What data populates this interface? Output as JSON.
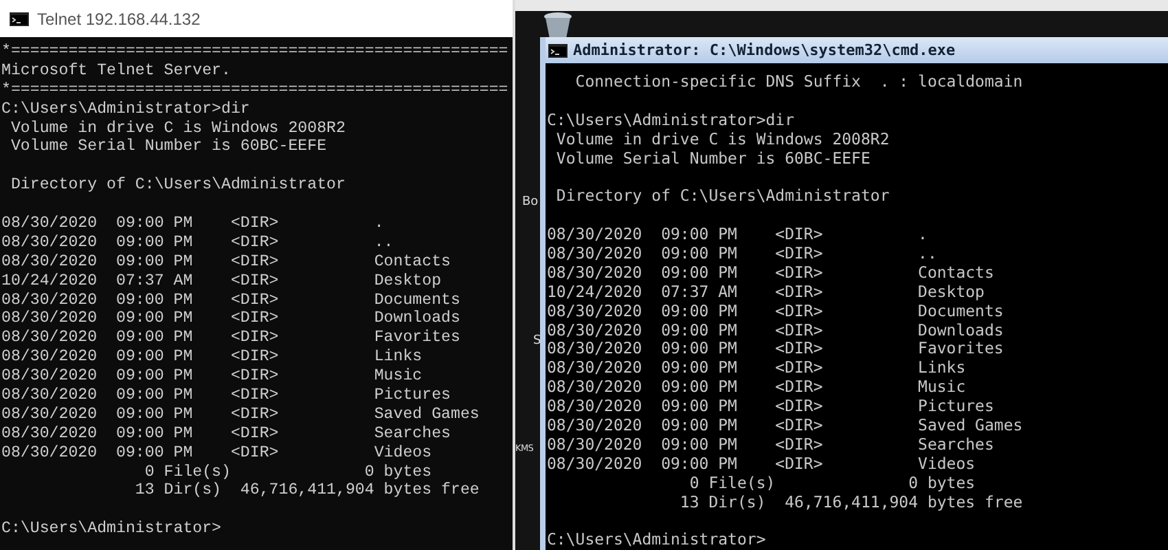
{
  "telnet_window": {
    "title": "Telnet 192.168.44.132",
    "blocks": [
      [
        "*====================================================",
        "Microsoft Telnet Server.",
        "*====================================================",
        "C:\\Users\\Administrator>dir",
        " Volume in drive C is Windows 2008R2",
        " Volume Serial Number is 60BC-EEFE"
      ],
      [
        " Directory of C:\\Users\\Administrator"
      ],
      [
        "08/30/2020  09:00 PM    <DIR>          .",
        "08/30/2020  09:00 PM    <DIR>          ..",
        "08/30/2020  09:00 PM    <DIR>          Contacts",
        "10/24/2020  07:37 AM    <DIR>          Desktop",
        "08/30/2020  09:00 PM    <DIR>          Documents",
        "08/30/2020  09:00 PM    <DIR>          Downloads",
        "08/30/2020  09:00 PM    <DIR>          Favorites",
        "08/30/2020  09:00 PM    <DIR>          Links",
        "08/30/2020  09:00 PM    <DIR>          Music",
        "08/30/2020  09:00 PM    <DIR>          Pictures",
        "08/30/2020  09:00 PM    <DIR>          Saved Games",
        "08/30/2020  09:00 PM    <DIR>          Searches",
        "08/30/2020  09:00 PM    <DIR>          Videos",
        "               0 File(s)              0 bytes",
        "              13 Dir(s)  46,716,411,904 bytes free"
      ],
      [
        "C:\\Users\\Administrator>"
      ]
    ]
  },
  "desktop": {
    "labels": [
      "Bo",
      "S",
      "KMS"
    ]
  },
  "cmd_window": {
    "title": "Administrator: C:\\Windows\\system32\\cmd.exe",
    "blocks": [
      [
        "   Connection-specific DNS Suffix  . : localdomain"
      ],
      [
        "C:\\Users\\Administrator>dir",
        " Volume in drive C is Windows 2008R2",
        " Volume Serial Number is 60BC-EEFE"
      ],
      [
        " Directory of C:\\Users\\Administrator"
      ],
      [
        "08/30/2020  09:00 PM    <DIR>          .",
        "08/30/2020  09:00 PM    <DIR>          ..",
        "08/30/2020  09:00 PM    <DIR>          Contacts",
        "10/24/2020  07:37 AM    <DIR>          Desktop",
        "08/30/2020  09:00 PM    <DIR>          Documents",
        "08/30/2020  09:00 PM    <DIR>          Downloads",
        "08/30/2020  09:00 PM    <DIR>          Favorites",
        "08/30/2020  09:00 PM    <DIR>          Links",
        "08/30/2020  09:00 PM    <DIR>          Music",
        "08/30/2020  09:00 PM    <DIR>          Pictures",
        "08/30/2020  09:00 PM    <DIR>          Saved Games",
        "08/30/2020  09:00 PM    <DIR>          Searches",
        "08/30/2020  09:00 PM    <DIR>          Videos",
        "               0 File(s)              0 bytes",
        "              13 Dir(s)  46,716,411,904 bytes free"
      ],
      [
        "C:\\Users\\Administrator>"
      ]
    ]
  }
}
